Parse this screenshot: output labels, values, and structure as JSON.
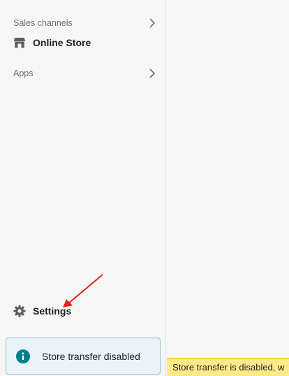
{
  "sidebar": {
    "sales_channels_label": "Sales channels",
    "online_store_label": "Online Store",
    "apps_label": "Apps",
    "settings_label": "Settings"
  },
  "transfer_card": {
    "text": "Store transfer disabled"
  },
  "banner": {
    "text": "Store transfer is disabled, w"
  },
  "colors": {
    "annotation_arrow": "#e8201a",
    "info_icon": "#007f8a",
    "banner_bg": "#ffea8a"
  },
  "icons": {
    "store": "store-icon",
    "settings": "gear-icon",
    "info": "info-icon",
    "chevron": "chevron-right-icon"
  }
}
